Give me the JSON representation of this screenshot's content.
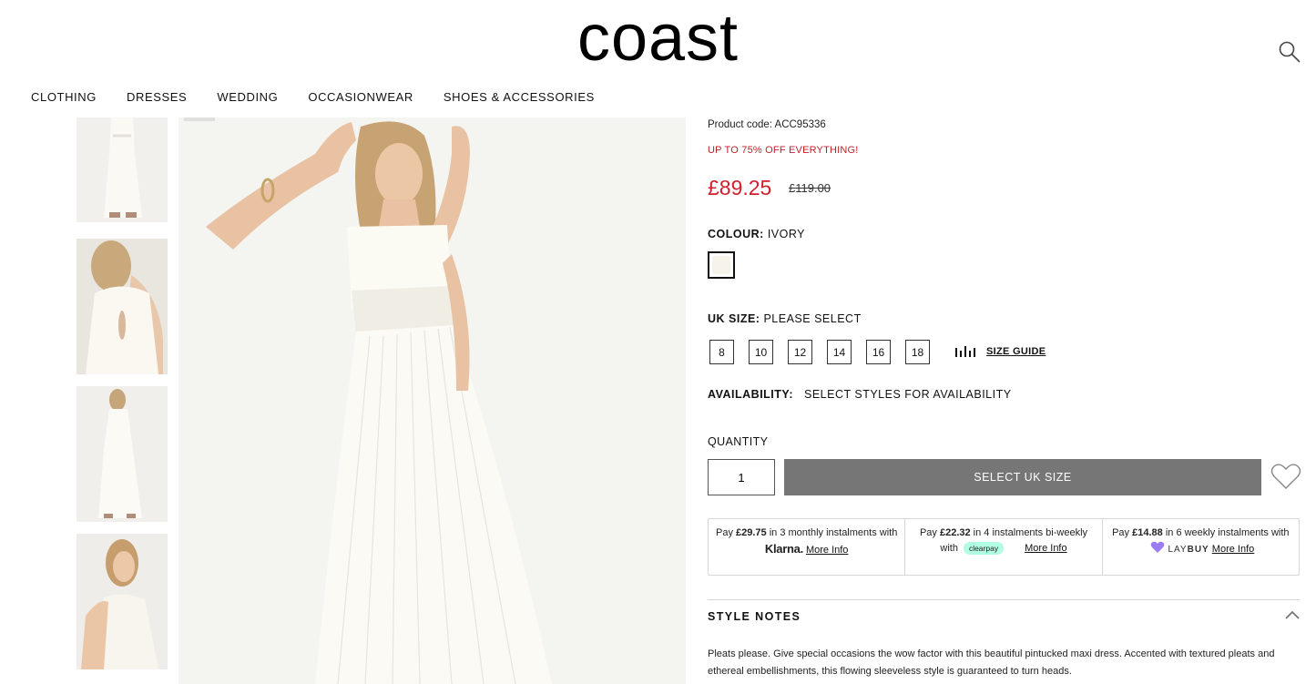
{
  "header": {
    "logo": "coast"
  },
  "nav": {
    "items": [
      "CLOTHING",
      "DRESSES",
      "WEDDING",
      "OCCASIONWEAR",
      "SHOES & ACCESSORIES"
    ]
  },
  "product": {
    "code_label": "Product code: ACC95336",
    "promo": "UP TO 75% OFF EVERYTHING!",
    "price_now": "£89.25",
    "price_was": "£119.00",
    "colour_label": "COLOUR:",
    "colour_value": "IVORY",
    "swatch_color": "#f6f3ea",
    "size_label": "UK SIZE:",
    "size_value": "PLEASE SELECT",
    "sizes": [
      "8",
      "10",
      "12",
      "14",
      "16",
      "18"
    ],
    "size_guide": "SIZE GUIDE",
    "availability_label": "AVAILABILITY:",
    "availability_value": "SELECT STYLES FOR AVAILABILITY",
    "quantity_label": "QUANTITY",
    "quantity_value": "1",
    "add_button": "SELECT UK SIZE"
  },
  "payments": {
    "klarna": {
      "pre": "Pay ",
      "amount": "£29.75",
      "mid": " in 3 monthly instalments with ",
      "brand": "Klarna.",
      "more": "More Info"
    },
    "clearpay": {
      "pre": "Pay ",
      "amount": "£22.32",
      "mid": " in 4 instalments bi-weekly with",
      "brand": "clearpay",
      "more": "More Info"
    },
    "laybuy": {
      "pre": "Pay ",
      "amount": "£14.88",
      "mid": " in 6 weekly instalments with",
      "brand_a": "LAY",
      "brand_b": "BUY",
      "more": "More Info"
    }
  },
  "style_notes": {
    "title": "STYLE NOTES",
    "text": "Pleats please. Give special occasions the wow factor with this beautiful pintucked maxi dress. Accented with textured pleats and ethereal embellishments, this flowing sleeveless style is guaranteed to turn heads."
  },
  "colors": {
    "sale_red": "#d0202e",
    "button_grey": "#767676"
  }
}
